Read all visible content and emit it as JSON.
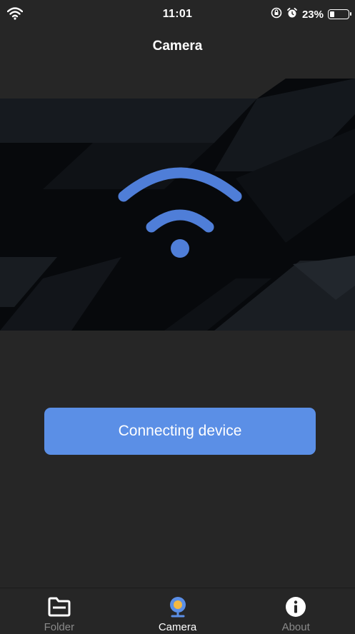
{
  "status_bar": {
    "time": "11:01",
    "battery": "23%",
    "icons": [
      "wifi-icon",
      "orientation-lock-icon",
      "alarm-icon",
      "battery-icon"
    ]
  },
  "nav": {
    "title": "Camera"
  },
  "hero": {
    "icon": "wifi-icon",
    "accent": "#4f7ed8"
  },
  "main": {
    "connect_label": "Connecting device",
    "button_color": "#5b8fe6"
  },
  "tabs": [
    {
      "label": "Folder",
      "icon": "folder-icon",
      "active": false
    },
    {
      "label": "Camera",
      "icon": "camera-icon",
      "active": true
    },
    {
      "label": "About",
      "icon": "info-icon",
      "active": false
    }
  ]
}
